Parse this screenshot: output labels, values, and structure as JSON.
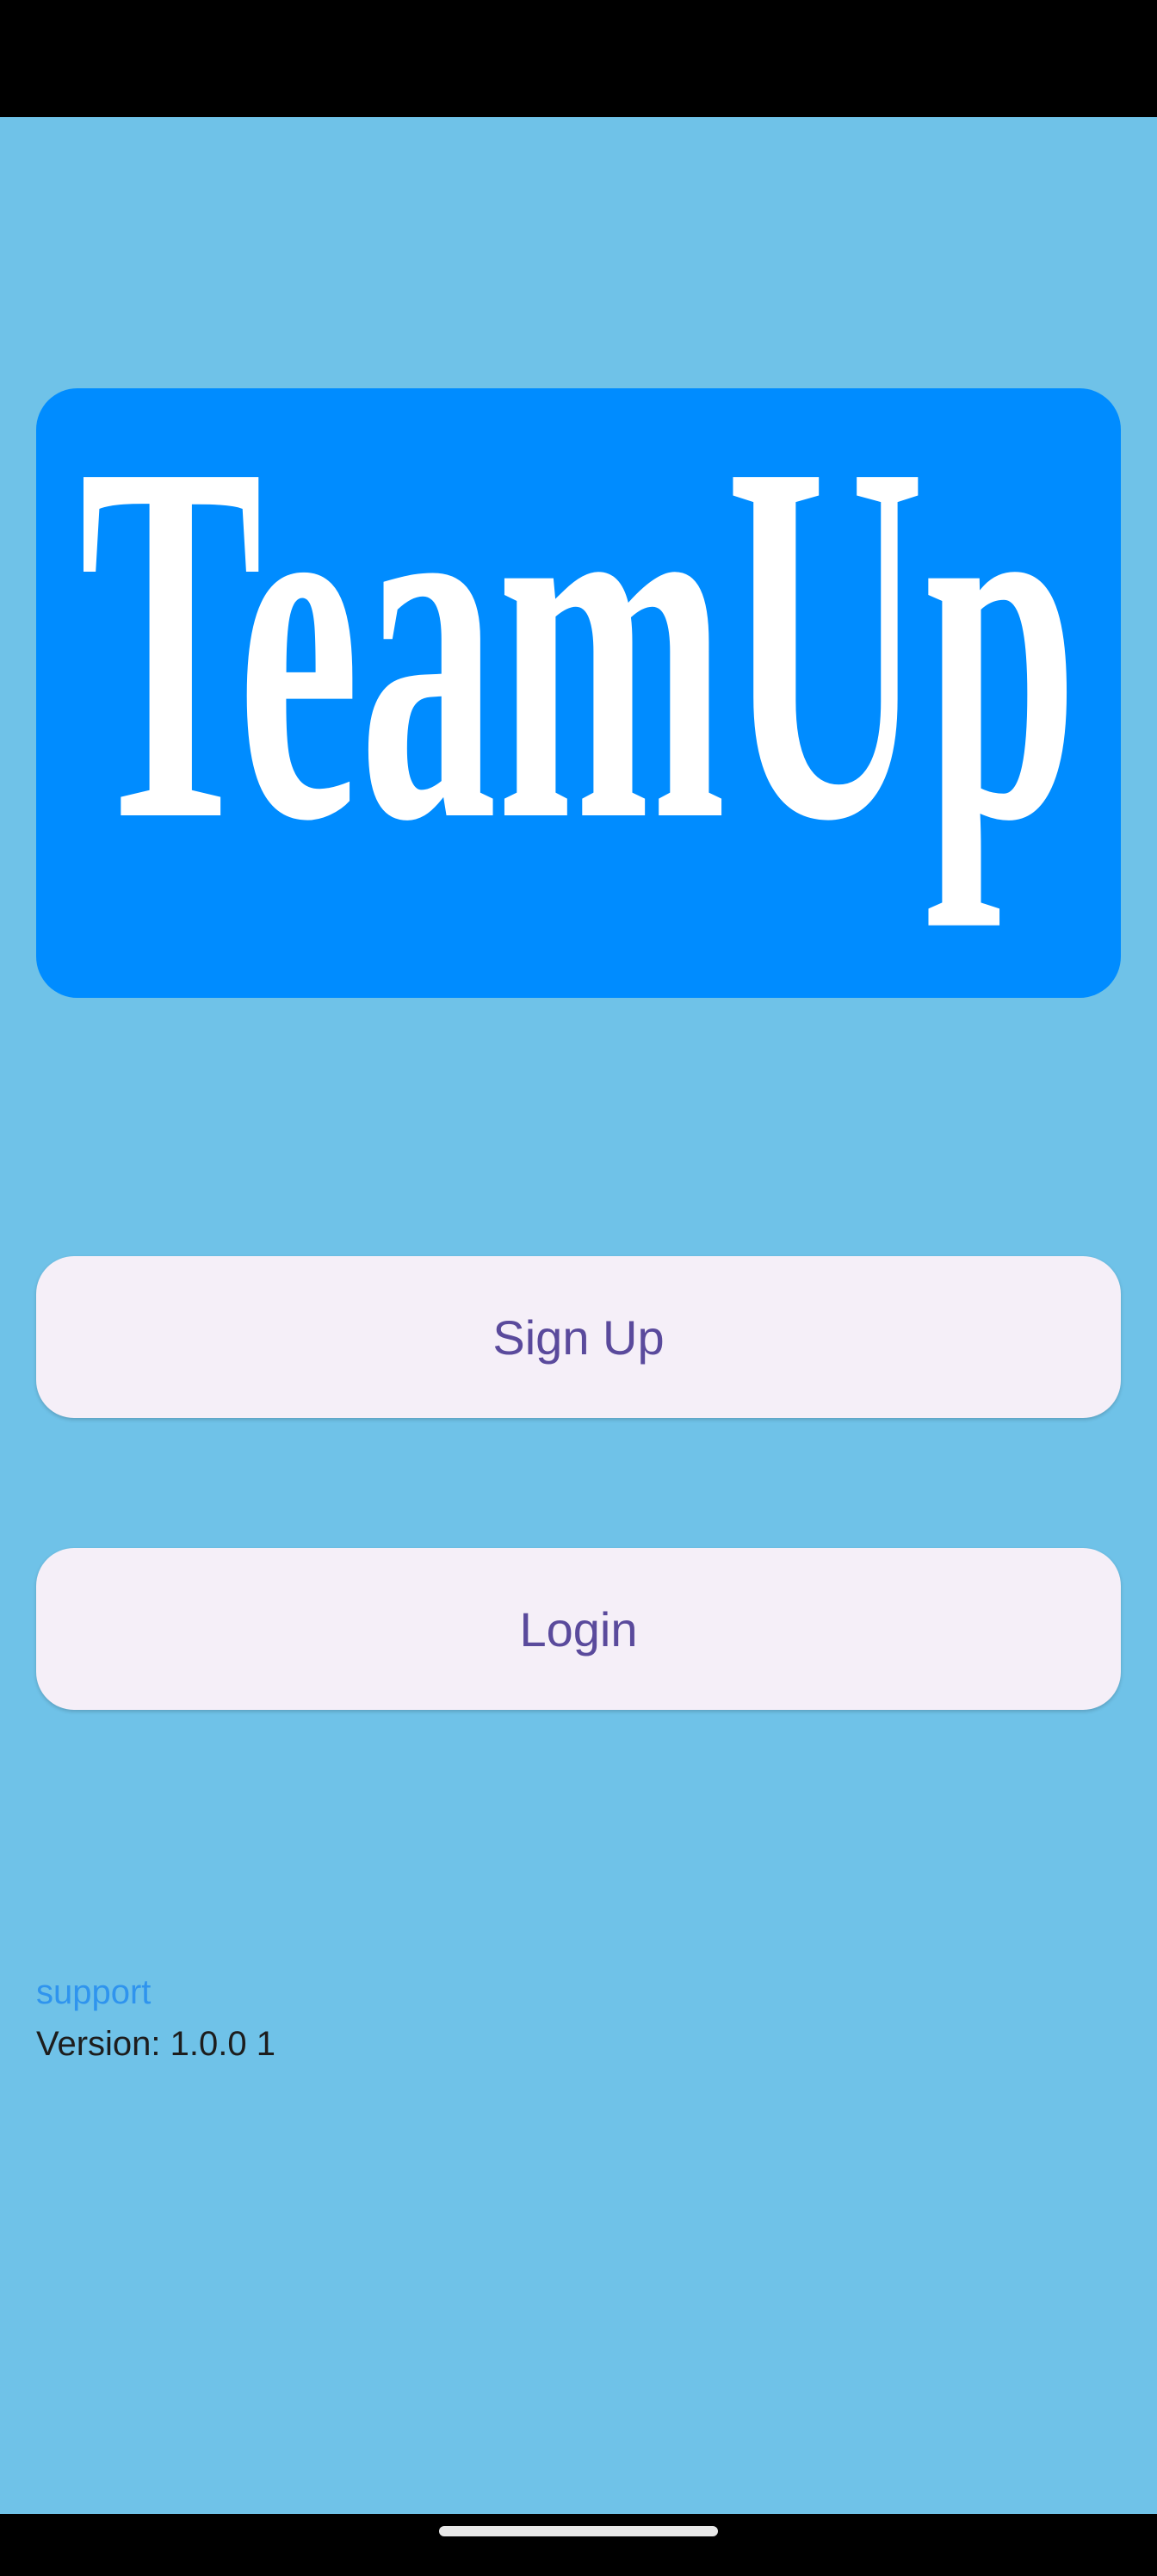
{
  "app": {
    "logo_text": "TeamUp",
    "logo_background": "#008cff",
    "screen_background": "#6fc2e8"
  },
  "actions": {
    "signup_label": "Sign Up",
    "login_label": "Login"
  },
  "footer": {
    "support_label": "support",
    "version_label": "Version:",
    "version_value": "1.0.0 1"
  },
  "colors": {
    "button_background": "#f5eff8",
    "button_text": "#5a4a9c",
    "link": "#2f94ee"
  }
}
